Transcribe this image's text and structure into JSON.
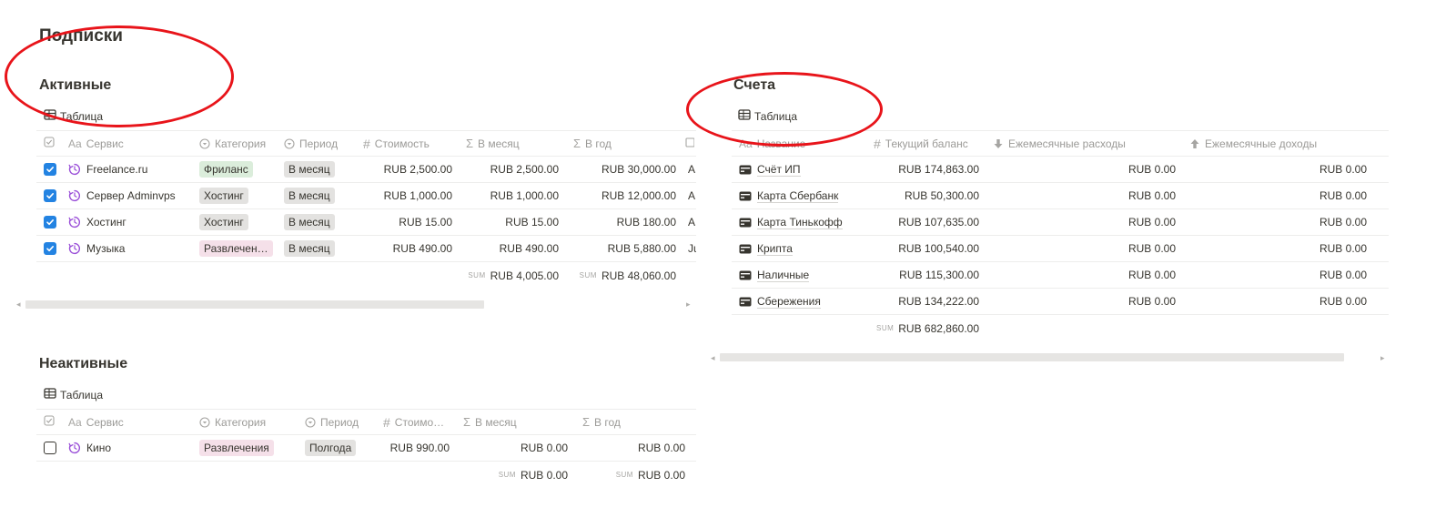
{
  "page": {
    "title": "Подписки"
  },
  "active": {
    "heading": "Активные",
    "view_label": "Таблица",
    "columns": {
      "check": "",
      "service": "Сервис",
      "category": "Категория",
      "period": "Период",
      "cost": "Стоимость",
      "monthly": "В месяц",
      "yearly": "В год",
      "extra": ""
    },
    "rows": [
      {
        "checked": true,
        "name": "Freelance.ru",
        "category": "Фриланс",
        "category_color": "#dbeddb",
        "period": "В месяц",
        "cost": "RUB 2,500.00",
        "monthly": "RUB 2,500.00",
        "yearly": "RUB 30,000.00",
        "extra": "A"
      },
      {
        "checked": true,
        "name": "Сервер Adminvps",
        "category": "Хостинг",
        "category_color": "#e3e2e0",
        "period": "В месяц",
        "cost": "RUB 1,000.00",
        "monthly": "RUB 1,000.00",
        "yearly": "RUB 12,000.00",
        "extra": "A"
      },
      {
        "checked": true,
        "name": "Хостинг",
        "category": "Хостинг",
        "category_color": "#e3e2e0",
        "period": "В месяц",
        "cost": "RUB 15.00",
        "monthly": "RUB 15.00",
        "yearly": "RUB 180.00",
        "extra": "A"
      },
      {
        "checked": true,
        "name": "Музыка",
        "category": "Развлечен…",
        "category_color": "#f5e0e9",
        "period": "В месяц",
        "cost": "RUB 490.00",
        "monthly": "RUB 490.00",
        "yearly": "RUB 5,880.00",
        "extra": "Ju"
      }
    ],
    "sum_label": "SUM",
    "sum_monthly": "RUB 4,005.00",
    "sum_yearly": "RUB 48,060.00"
  },
  "inactive": {
    "heading": "Неактивные",
    "view_label": "Таблица",
    "columns": {
      "service": "Сервис",
      "category": "Категория",
      "period": "Период",
      "cost": "Стоимо…",
      "monthly": "В месяц",
      "yearly": "В год"
    },
    "rows": [
      {
        "checked": false,
        "name": "Кино",
        "category": "Развлечения",
        "category_color": "#f5e0e9",
        "period": "Полгода",
        "cost": "RUB 990.00",
        "monthly": "RUB 0.00",
        "yearly": "RUB 0.00"
      }
    ],
    "sum_label": "SUM",
    "sum_monthly": "RUB 0.00",
    "sum_yearly": "RUB 0.00"
  },
  "accounts": {
    "heading": "Счета",
    "view_label": "Таблица",
    "columns": {
      "name": "Название",
      "balance": "Текущий баланс",
      "expenses": "Ежемесячные расходы",
      "income": "Ежемесячные доходы"
    },
    "rows": [
      {
        "name": "Счёт ИП",
        "balance": "RUB 174,863.00",
        "expenses": "RUB 0.00",
        "income": "RUB 0.00"
      },
      {
        "name": "Карта Сбербанк",
        "balance": "RUB 50,300.00",
        "expenses": "RUB 0.00",
        "income": "RUB 0.00"
      },
      {
        "name": "Карта Тинькофф",
        "balance": "RUB 107,635.00",
        "expenses": "RUB 0.00",
        "income": "RUB 0.00"
      },
      {
        "name": "Крипта",
        "balance": "RUB 100,540.00",
        "expenses": "RUB 0.00",
        "income": "RUB 0.00"
      },
      {
        "name": "Наличные",
        "balance": "RUB 115,300.00",
        "expenses": "RUB 0.00",
        "income": "RUB 0.00"
      },
      {
        "name": "Сбережения",
        "balance": "RUB 134,222.00",
        "expenses": "RUB 0.00",
        "income": "RUB 0.00"
      }
    ],
    "sum_label": "SUM",
    "sum_balance": "RUB 682,860.00"
  },
  "icons": {
    "table": "table-icon",
    "checkbox_header": "checkbox-column-icon",
    "text": "text-type-icon",
    "select": "select-type-icon",
    "number": "number-type-icon",
    "formula": "sigma-icon",
    "arrow_down": "arrow-down-icon",
    "arrow_up": "arrow-up-icon",
    "cycle": "recurring-icon",
    "card": "credit-card-icon"
  },
  "colors": {
    "accent": "#2383e2",
    "annotation": "#e8141a",
    "cycle_icon": "#9a4fd8"
  }
}
